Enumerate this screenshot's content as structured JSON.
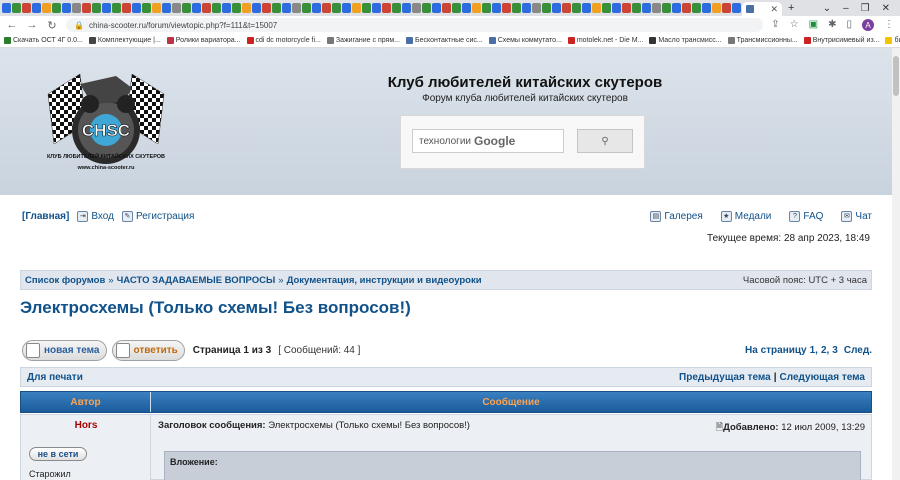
{
  "browser": {
    "url": "china-scooter.ru/forum/viewtopic.php?f=111&t=15007",
    "profile_initial": "A",
    "bookmarks": [
      {
        "label": "Скачать ОСТ 4Г 0.0...",
        "color": "#2a7d2a"
      },
      {
        "label": "Комплектующие |...",
        "color": "#444"
      },
      {
        "label": "Ролики вариатора...",
        "color": "#b34"
      },
      {
        "label": "cdi dc motorcycle fi...",
        "color": "#cc2222"
      },
      {
        "label": "Зажигание с прям...",
        "color": "#777"
      },
      {
        "label": "Бесконтактные сис...",
        "color": "#4a6fa5"
      },
      {
        "label": "Схемы коммутато...",
        "color": "#4a6fa5"
      },
      {
        "label": "motolek.net - Die M...",
        "color": "#cc2222"
      },
      {
        "label": "Масло трансмисс...",
        "color": "#333"
      },
      {
        "label": "Трансмиссионны...",
        "color": "#777"
      },
      {
        "label": "Внутрисимевый из...",
        "color": "#cc2222"
      },
      {
        "label": "билайн (кс. Мой Б...",
        "color": "#f3c200"
      }
    ]
  },
  "header": {
    "title": "Клуб любителей китайских скутеров",
    "description": "Форум клуба любителей китайских скутеров",
    "logo_text": "CHSC",
    "logo_caption": "КЛУБ ЛЮБИТЕЛЕЙ КИТАЙСКИХ СКУТЕРОВ",
    "logo_url": "www.china-scooter.ru",
    "search_placeholder": "технологии",
    "search_brand": "Google"
  },
  "nav": {
    "main": "[Главная]",
    "login": "Вход",
    "register": "Регистрация",
    "gallery": "Галерея",
    "medals": "Медали",
    "faq": "FAQ",
    "chat": "Чат"
  },
  "current_time": "Текущее время: 28 апр 2023, 18:49",
  "breadcrumb": {
    "items": [
      "Список форумов",
      "ЧАСТО ЗАДАВАЕМЫЕ ВОПРОСЫ",
      "Документация, инструкции и видеоуроки"
    ],
    "separator": "»",
    "timezone": "Часовой пояс: UTC + 3 часа"
  },
  "topic": {
    "title": "Электросхемы (Только схемы! Без вопросов!)"
  },
  "actions": {
    "new_topic": "новая тема",
    "reply": "ответить",
    "page_info": "Страница 1 из 3",
    "message_count": "[ Сообщений: 44 ]",
    "pager_label": "На страницу",
    "pages": [
      "1,",
      "2,",
      "3"
    ],
    "next": "След."
  },
  "table": {
    "print": "Для печати",
    "prev_topic": "Предыдущая тема",
    "next_topic": "Следующая тема",
    "col_author": "Автор",
    "col_message": "Сообщение"
  },
  "post": {
    "author": "Hors",
    "status": "не в сети",
    "rank": "Старожил",
    "subject_label": "Заголовок сообщения:",
    "subject": "Электросхемы (Только схемы! Без вопросов!)",
    "date_label": "Добавлено:",
    "date": "12 июл 2009, 13:29",
    "attachment_label": "Вложение:"
  }
}
